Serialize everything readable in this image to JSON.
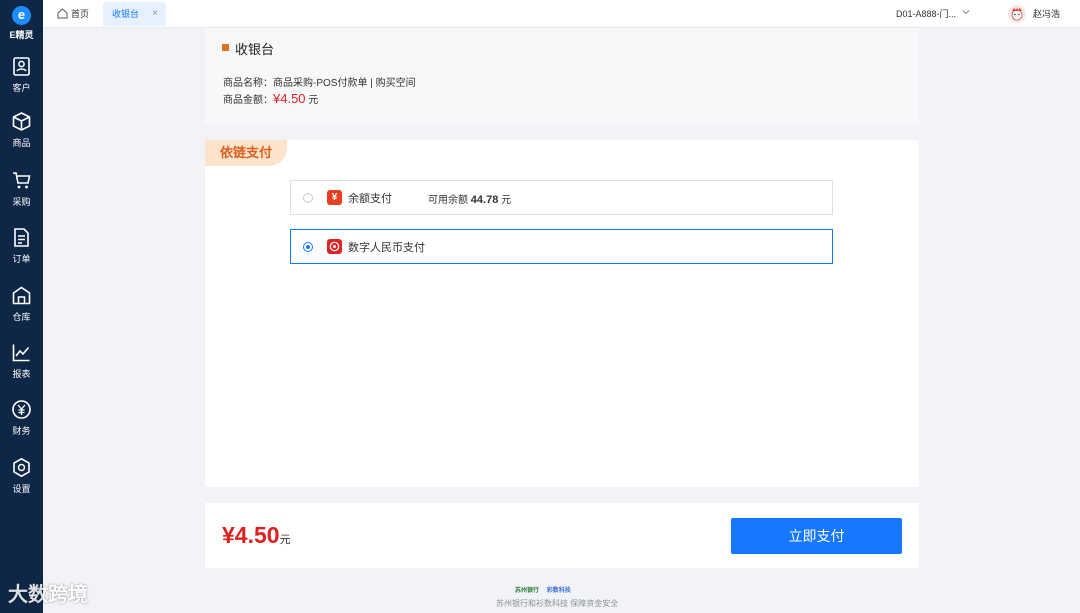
{
  "app": {
    "logo_letter": "e",
    "logo_text": "E精灵",
    "accent": "#1677ff",
    "sidebar_bg": "#0f2746"
  },
  "sidebar": {
    "items": [
      {
        "label": "客户",
        "icon": "customer-icon"
      },
      {
        "label": "商品",
        "icon": "box-icon"
      },
      {
        "label": "采购",
        "icon": "cart-icon"
      },
      {
        "label": "订单",
        "icon": "document-icon"
      },
      {
        "label": "仓库",
        "icon": "warehouse-icon"
      },
      {
        "label": "报表",
        "icon": "chart-icon"
      },
      {
        "label": "财务",
        "icon": "yuan-icon"
      },
      {
        "label": "设置",
        "icon": "settings-icon"
      }
    ]
  },
  "topbar": {
    "home_tab": "首页",
    "active_tab": "收银台",
    "close_glyph": "×",
    "store": "D01-A888-门...",
    "user": "赵冯浩"
  },
  "order": {
    "title": "收银台",
    "name_label": "商品名称：",
    "name_value": "商品采购-POS付款单 | 购买空间",
    "amount_label": "商品金额：",
    "amount_value": "¥4.50",
    "amount_unit": "元"
  },
  "payment": {
    "header": "依链支付",
    "options": [
      {
        "label": "余额支付",
        "icon": "wallet-yuan-icon",
        "balance_label": "可用余额",
        "balance_value": "44.78",
        "balance_unit": "元",
        "selected": false
      },
      {
        "label": "数字人民币支付",
        "icon": "digital-rmb-icon",
        "selected": true
      }
    ]
  },
  "bottom": {
    "total": "¥4.50",
    "total_unit": "元",
    "pay_button": "立即支付"
  },
  "footer": {
    "bank_logo": "苏州银行",
    "tech_logo": "彩数科技",
    "text": "苏州银行和衫数科技 保障资金安全"
  },
  "watermark": "大数跨境"
}
